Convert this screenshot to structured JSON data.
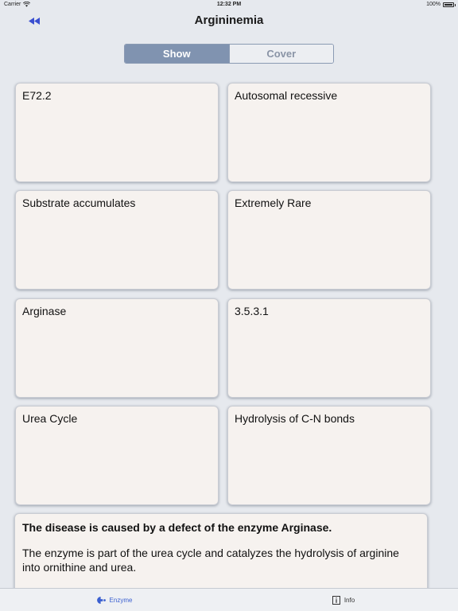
{
  "status_bar": {
    "carrier": "Carrier",
    "time": "12:32 PM",
    "battery": "100%"
  },
  "nav": {
    "title": "Argininemia",
    "back_icon": "rewind-icon"
  },
  "segmented_control": {
    "options": [
      "Show",
      "Cover"
    ],
    "selected": "Show"
  },
  "cards": [
    {
      "text": "E72.2"
    },
    {
      "text": "Autosomal recessive"
    },
    {
      "text": "Substrate accumulates"
    },
    {
      "text": "Extremely Rare"
    },
    {
      "text": "Arginase"
    },
    {
      "text": "3.5.3.1"
    },
    {
      "text": "Urea Cycle"
    },
    {
      "text": "Hydrolysis of C-N bonds"
    }
  ],
  "description": {
    "title": "The disease is caused by a defect of the enzyme Arginase.",
    "body": "The enzyme is part of the urea cycle and catalyzes the hydrolysis of arginine into ornithine and urea."
  },
  "tab_bar": {
    "tabs": [
      {
        "label": "Enzyme",
        "icon": "enzyme-icon",
        "active": true
      },
      {
        "label": "Info",
        "icon": "info-icon",
        "active": false
      }
    ]
  },
  "colors": {
    "accent": "#3a5fd0",
    "segment_selected": "#8093b0",
    "card_bg": "#f6f2ef",
    "background": "#e6e9ee"
  }
}
